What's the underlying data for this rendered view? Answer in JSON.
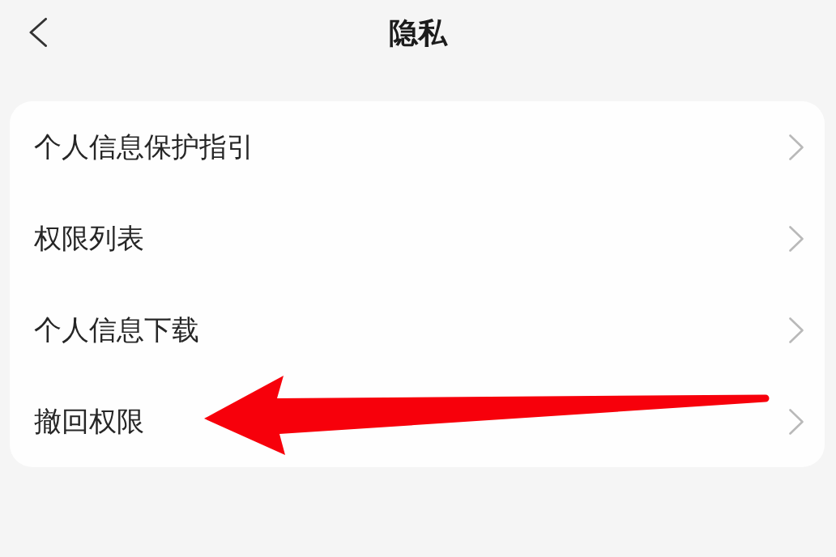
{
  "header": {
    "title": "隐私"
  },
  "items": [
    {
      "label": "个人信息保护指引"
    },
    {
      "label": "权限列表"
    },
    {
      "label": "个人信息下载"
    },
    {
      "label": "撤回权限"
    }
  ]
}
